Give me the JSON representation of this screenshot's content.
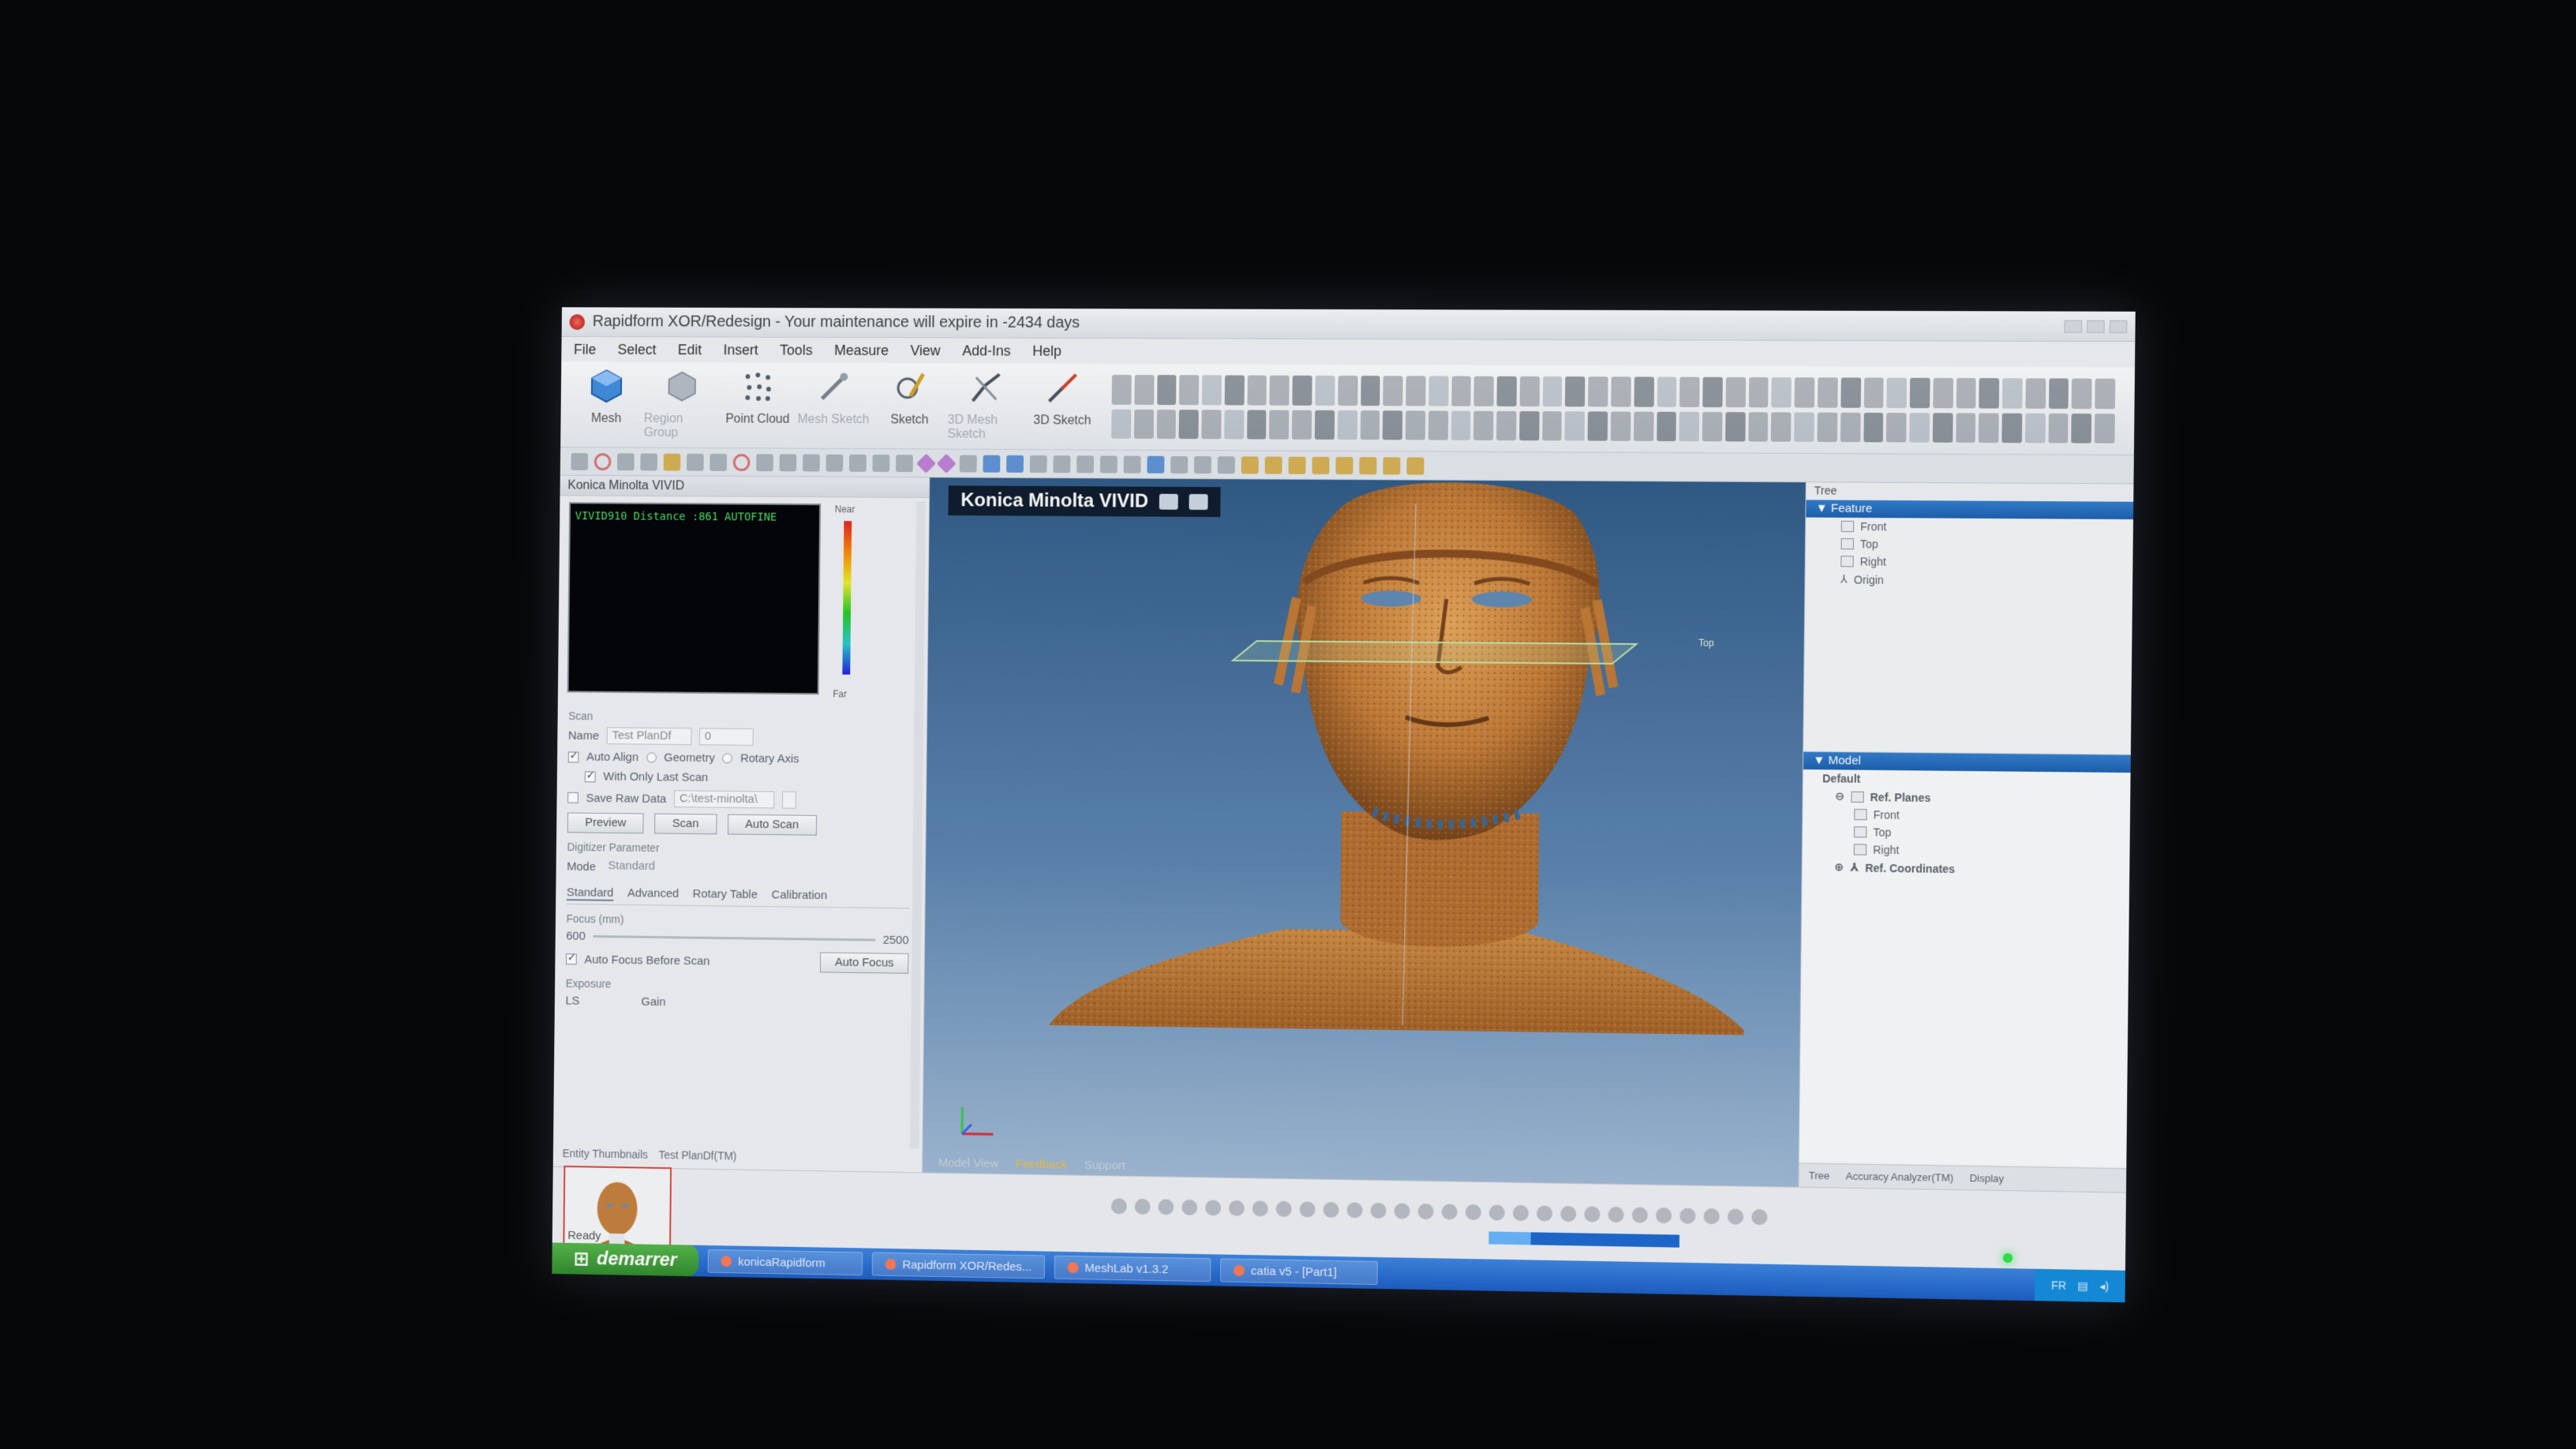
{
  "window": {
    "title": "Rapidform XOR/Redesign - Your maintenance will expire in -2434 days"
  },
  "menu": [
    "File",
    "Select",
    "Edit",
    "Insert",
    "Tools",
    "Measure",
    "View",
    "Add-Ins",
    "Help"
  ],
  "ribbon": {
    "mesh": "Mesh",
    "region_group": "Region Group",
    "point_cloud": "Point Cloud",
    "mesh_sketch": "Mesh Sketch",
    "sketch": "Sketch",
    "mesh_sketch_3d": "3D Mesh Sketch",
    "sketch_3d": "3D Sketch"
  },
  "left_panel": {
    "title": "Konica Minolta VIVID",
    "preview_status": "VIVID910 Distance :861 AUTOFINE",
    "legend_near": "Near",
    "legend_far": "Far",
    "scan_section": "Scan",
    "name_label": "Name",
    "name_value": "Test PlanDf",
    "name_index": "0",
    "auto_align": "Auto Align",
    "geometry": "Geometry",
    "rotary_axis": "Rotary Axis",
    "with_only_last_scan": "With Only Last Scan",
    "save_raw_data": "Save Raw Data",
    "save_path": "C:\\test-minolta\\",
    "preview_btn": "Preview",
    "scan_btn": "Scan",
    "auto_scan_btn": "Auto Scan",
    "digitizer_param": "Digitizer Parameter",
    "mode_label": "Mode",
    "mode_value": "Standard",
    "tabs": [
      "Standard",
      "Advanced",
      "Rotary Table",
      "Calibration"
    ],
    "focus_label": "Focus (mm)",
    "focus_min": "600",
    "focus_max": "2500",
    "auto_focus_before_scan": "Auto Focus Before Scan",
    "auto_focus_btn": "Auto Focus",
    "exposure_label": "Exposure",
    "exposure_value": "LS",
    "gain_label": "Gain"
  },
  "viewport": {
    "title": "Konica Minolta VIVID",
    "plane_label": "Top",
    "tabs": [
      "Model View",
      "Feedback",
      "Support"
    ]
  },
  "tree": {
    "head": "Tree",
    "feature_header": "Feature",
    "feature_items": [
      "Front",
      "Top",
      "Right",
      "Origin"
    ],
    "model_header": "Model",
    "model_default": "Default",
    "ref_planes": "Ref. Planes",
    "ref_plane_items": [
      "Front",
      "Top",
      "Right"
    ],
    "ref_coordinates": "Ref. Coordinates",
    "footer_tabs": [
      "Tree",
      "Accuracy Analyzer(TM)",
      "Display"
    ]
  },
  "bottom": {
    "entity_thumbnails": "Entity Thumbnails",
    "thumb_label": "Test PlanDf(TM)",
    "progress": 0.22,
    "status": "Ready"
  },
  "taskbar": {
    "start": "demarrer",
    "tasks": [
      "konicaRapidform",
      "Rapidform XOR/Redes...",
      "MeshLab v1.3.2",
      "catia v5 - [Part1]"
    ],
    "tray_lang": "FR"
  },
  "colors": {
    "accent_blue": "#1b62b5",
    "mesh_copper": "#c77a32",
    "preview_green": "#48e060"
  }
}
